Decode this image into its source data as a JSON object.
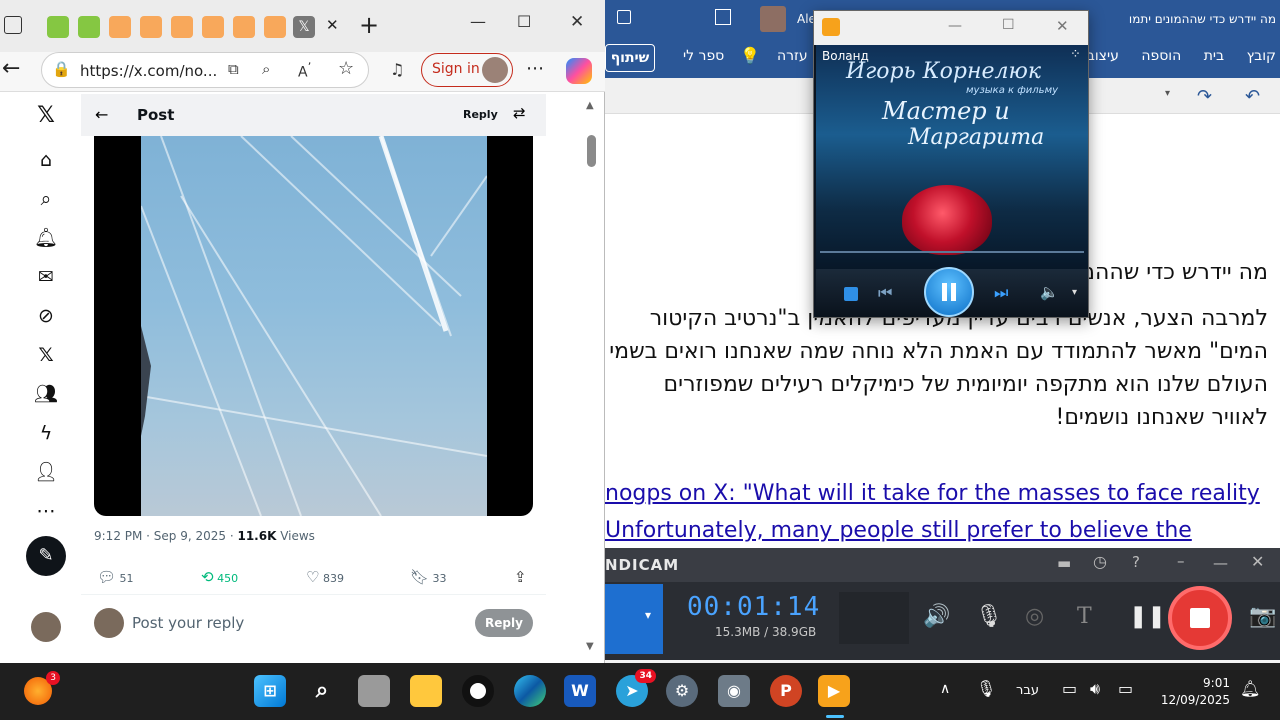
{
  "browser": {
    "url": "https://x.com/no...",
    "sign_in_label": "Sign in",
    "close_tab": "✕",
    "new_tab": "+"
  },
  "post": {
    "header_title": "Post",
    "header_reply": "Reply",
    "timestamp": "9:12 PM · Sep 9, 2025 · ",
    "views_count": "11.6K",
    "views_label": " Views",
    "replies": "51",
    "reposts": "450",
    "likes": "839",
    "bookmarks": "33",
    "reply_placeholder": "Post your reply",
    "reply_button": "Reply"
  },
  "word": {
    "title_short": "Ale",
    "title_doc": "מה יידרש כדי שההמונים יתמו",
    "ribbon_tabs": [
      "קובץ",
      "בית",
      "הוספה",
      "עיצוב",
      "עזרה"
    ],
    "share_label": "שיתוף",
    "read_aloud": "ספר לי",
    "heading": "מה יידרש כדי שההמונים יתמודדו עם המציאות",
    "paragraph": "למרבה הצער, אנשים רבים עדיין מעדיפים להאמין ב\"נרטיב הקיטור המים\" מאשר להתמודד עם האמת הלא נוחה שמה שאנחנו רואים בשמי העולם שלנו הוא מתקפה יומיומית של כימיקלים רעילים שמפוזרים לאוויר שאנחנו נושמים!",
    "link_line1": "nogps on X: \"What will it take for the masses to face reality",
    "link_line2": "Unfortunately, many people still prefer to believe the"
  },
  "player": {
    "title": "Воланд",
    "album_line1": "Игорь Корнелюк",
    "album_line2": "Мастер и",
    "album_line3": "Маргарита",
    "album_sub": "музыка к фильму"
  },
  "bandicam": {
    "brand": "NDICAM",
    "timer": "00:01:14",
    "size": "15.3MB / 38.9GB"
  },
  "taskbar": {
    "notif_badge": "3",
    "telegram_badge": "34",
    "language": "עבר",
    "time": "9:01",
    "date": "12/09/2025"
  }
}
